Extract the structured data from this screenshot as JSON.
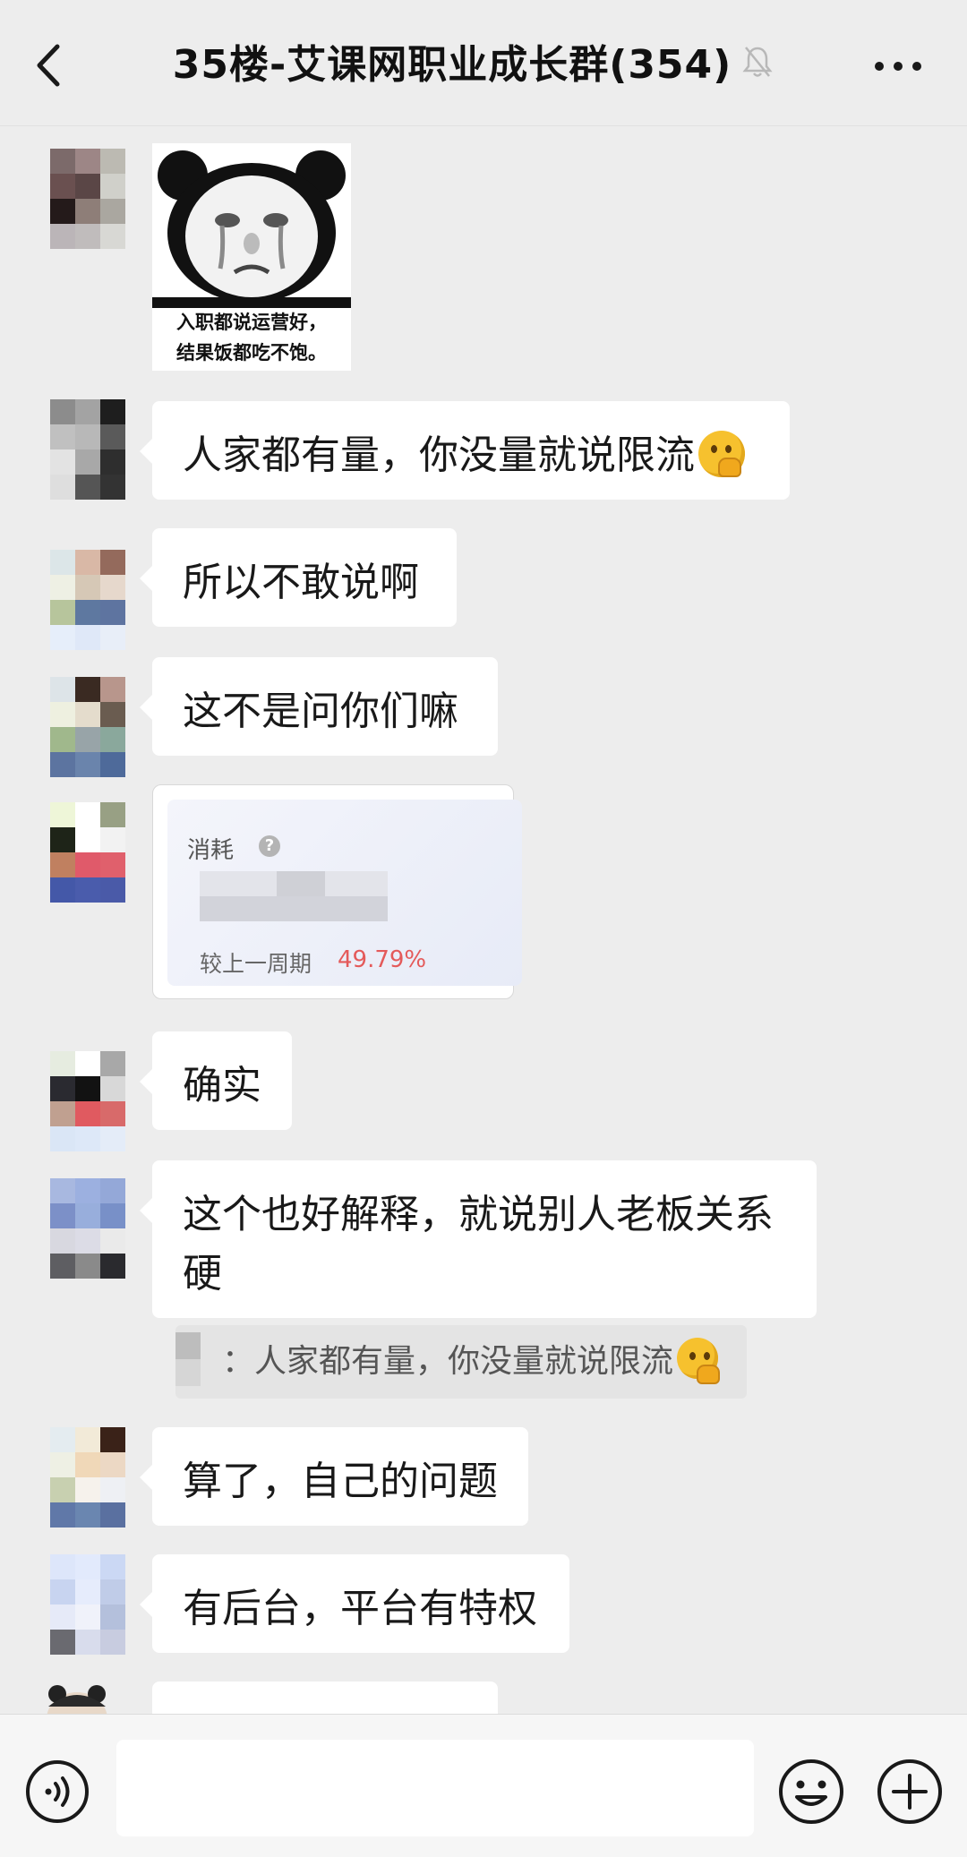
{
  "header": {
    "title": "35楼-艾课网职业成长群(354)"
  },
  "sticker": {
    "caption_line1": "入职都说运营好，",
    "caption_line2": "结果饭都吃不饱。"
  },
  "messages": [
    {
      "text": "人家都有量，你没量就说限流",
      "emoji": "thinking-face"
    },
    {
      "text": "所以不敢说啊"
    },
    {
      "text": "这不是问你们嘛"
    },
    {
      "text": "确实"
    },
    {
      "text_line1": "这个也好解释，就说别人老板关系",
      "text_line2": "硬"
    },
    {
      "text": "算了，自己的问题"
    },
    {
      "text": "有后台，平台有特权"
    }
  ],
  "stat_card": {
    "label": "消耗",
    "compare_label": "较上一周期",
    "percent": "49.79%"
  },
  "quote": {
    "text": "：人家都有量，你没量就说限流",
    "emoji": "thinking-face"
  },
  "colors": {
    "background": "#ededed",
    "bubble": "#ffffff",
    "percent_red": "#e45a5a"
  },
  "icons": [
    "back-arrow-icon",
    "mute-bell-icon",
    "more-dots-icon",
    "voice-icon",
    "emoji-icon",
    "plus-icon",
    "help-icon"
  ]
}
